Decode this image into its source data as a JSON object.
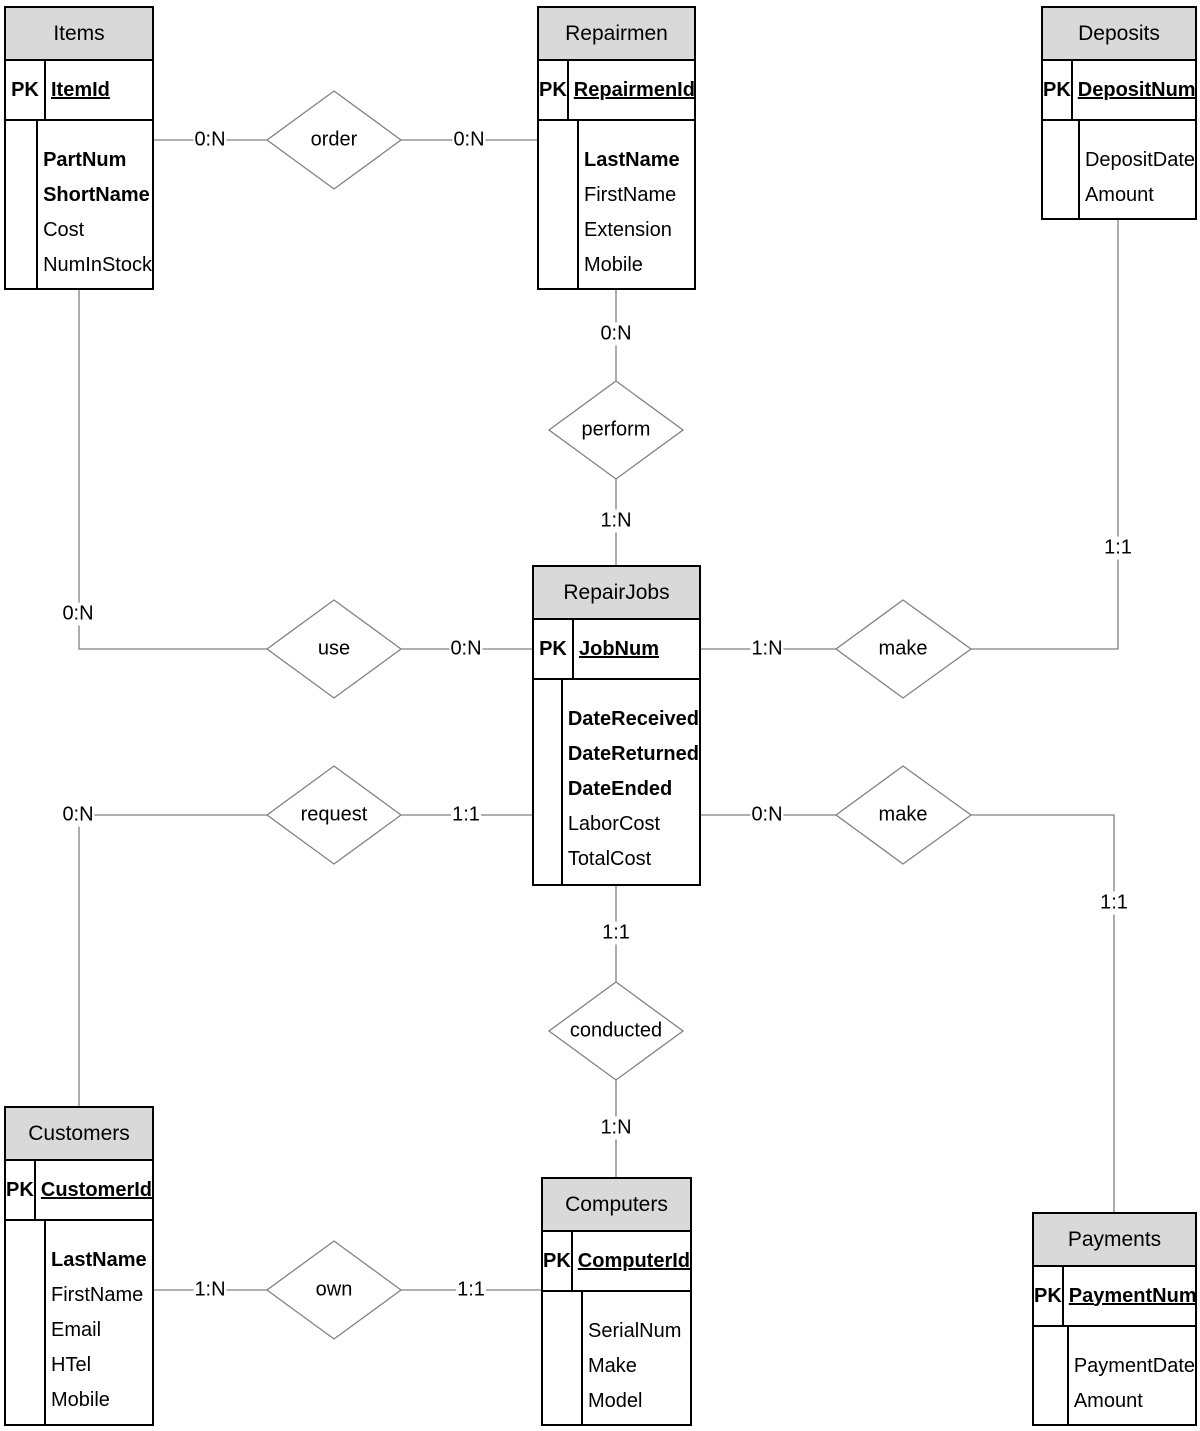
{
  "entities": {
    "items": {
      "title": "Items",
      "pk_label": "PK",
      "pk": "ItemId",
      "attrs": [
        {
          "name": "PartNum",
          "bold": true
        },
        {
          "name": "ShortName",
          "bold": true
        },
        {
          "name": "Cost",
          "bold": false
        },
        {
          "name": "NumInStock",
          "bold": false
        }
      ]
    },
    "repairmen": {
      "title": "Repairmen",
      "pk_label": "PK",
      "pk": "RepairmenId",
      "attrs": [
        {
          "name": "LastName",
          "bold": true
        },
        {
          "name": "FirstName",
          "bold": false
        },
        {
          "name": "Extension",
          "bold": false
        },
        {
          "name": "Mobile",
          "bold": false
        }
      ]
    },
    "deposits": {
      "title": "Deposits",
      "pk_label": "PK",
      "pk": "DepositNum",
      "attrs": [
        {
          "name": "DepositDate",
          "bold": false
        },
        {
          "name": "Amount",
          "bold": false
        }
      ]
    },
    "repairjobs": {
      "title": "RepairJobs",
      "pk_label": "PK",
      "pk": "JobNum",
      "attrs": [
        {
          "name": "DateReceived",
          "bold": true
        },
        {
          "name": "DateReturned",
          "bold": true
        },
        {
          "name": "DateEnded",
          "bold": true
        },
        {
          "name": "LaborCost",
          "bold": false
        },
        {
          "name": "TotalCost",
          "bold": false
        }
      ]
    },
    "customers": {
      "title": "Customers",
      "pk_label": "PK",
      "pk": "CustomerId",
      "attrs": [
        {
          "name": "LastName",
          "bold": true
        },
        {
          "name": "FirstName",
          "bold": false
        },
        {
          "name": "Email",
          "bold": false
        },
        {
          "name": "HTel",
          "bold": false
        },
        {
          "name": "Mobile",
          "bold": false
        }
      ]
    },
    "computers": {
      "title": "Computers",
      "pk_label": "PK",
      "pk": "ComputerId",
      "attrs": [
        {
          "name": "SerialNum",
          "bold": false
        },
        {
          "name": "Make",
          "bold": false
        },
        {
          "name": "Model",
          "bold": false
        }
      ]
    },
    "payments": {
      "title": "Payments",
      "pk_label": "PK",
      "pk": "PaymentNum",
      "attrs": [
        {
          "name": "PaymentDate",
          "bold": false
        },
        {
          "name": "Amount",
          "bold": false
        }
      ]
    }
  },
  "relationships": {
    "order": {
      "label": "order",
      "from": "Items",
      "to": "Repairmen",
      "card_from": "0:N",
      "card_to": "0:N"
    },
    "perform": {
      "label": "perform",
      "from": "Repairmen",
      "to": "RepairJobs",
      "card_from": "0:N",
      "card_to": "1:N"
    },
    "use": {
      "label": "use",
      "from": "Items",
      "to": "RepairJobs",
      "card_from": "0:N",
      "card_to": "0:N"
    },
    "make_deposit": {
      "label": "make",
      "from": "RepairJobs",
      "to": "Deposits",
      "card_from": "1:N",
      "card_to": "1:1"
    },
    "request": {
      "label": "request",
      "from": "Customers",
      "to": "RepairJobs",
      "card_from": "0:N",
      "card_to": "1:1"
    },
    "make_payment": {
      "label": "make",
      "from": "RepairJobs",
      "to": "Payments",
      "card_from": "0:N",
      "card_to": "1:1"
    },
    "conducted": {
      "label": "conducted",
      "from": "RepairJobs",
      "to": "Computers",
      "card_from": "1:1",
      "card_to": "1:N"
    },
    "own": {
      "label": "own",
      "from": "Customers",
      "to": "Computers",
      "card_from": "1:N",
      "card_to": "1:1"
    }
  }
}
